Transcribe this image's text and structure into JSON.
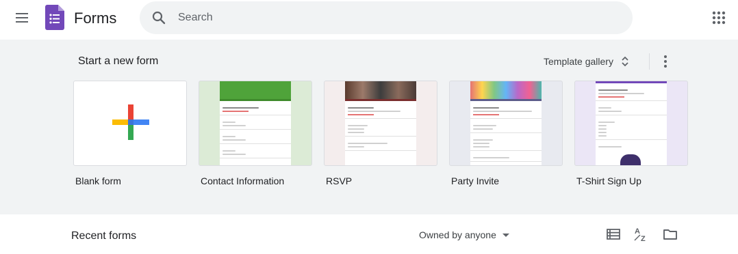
{
  "header": {
    "app_title": "Forms",
    "search_placeholder": "Search",
    "icons": [
      "main-menu-icon",
      "forms-logo",
      "search-icon",
      "apps-grid-icon"
    ]
  },
  "templates_section": {
    "title": "Start a new form",
    "gallery_label": "Template gallery",
    "cards": [
      {
        "label": "Blank form"
      },
      {
        "label": "Contact Information"
      },
      {
        "label": "RSVP"
      },
      {
        "label": "Party Invite"
      },
      {
        "label": "T-Shirt Sign Up"
      }
    ]
  },
  "recent_section": {
    "title": "Recent forms",
    "owner_filter": "Owned by anyone",
    "icons": [
      "list-view-icon",
      "sort-az-icon",
      "folder-icon"
    ]
  },
  "colors": {
    "brand_purple": "#7248b9",
    "band_gray": "#f1f3f4",
    "text": "#202124",
    "icon_gray": "#5f6368"
  }
}
